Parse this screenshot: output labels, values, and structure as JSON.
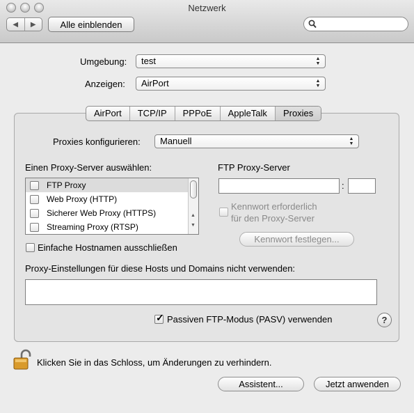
{
  "window": {
    "title": "Netzwerk"
  },
  "toolbar": {
    "back_icon": "◀",
    "forward_icon": "▶",
    "show_all_label": "Alle einblenden",
    "search_placeholder": "",
    "search_icon": "search-icon"
  },
  "location": {
    "label": "Umgebung:",
    "value": "test"
  },
  "show": {
    "label": "Anzeigen:",
    "value": "AirPort"
  },
  "tabs": [
    {
      "label": "AirPort",
      "selected": false
    },
    {
      "label": "TCP/IP",
      "selected": false
    },
    {
      "label": "PPPoE",
      "selected": false
    },
    {
      "label": "AppleTalk",
      "selected": false
    },
    {
      "label": "Proxies",
      "selected": true
    }
  ],
  "proxies": {
    "configure_label": "Proxies konfigurieren:",
    "configure_value": "Manuell",
    "select_server_label": "Einen Proxy-Server auswählen:",
    "server_list": [
      {
        "label": "FTP Proxy",
        "checked": false,
        "selected": true
      },
      {
        "label": "Web Proxy (HTTP)",
        "checked": false,
        "selected": false
      },
      {
        "label": "Sicherer Web Proxy (HTTPS)",
        "checked": false,
        "selected": false
      },
      {
        "label": "Streaming Proxy (RTSP)",
        "checked": false,
        "selected": false
      }
    ],
    "ftp_server_title": "FTP Proxy-Server",
    "ftp_server_value": "",
    "port_separator": ":",
    "port_value": "",
    "password_required_line1": "Kennwort erforderlich",
    "password_required_line2": "für den Proxy-Server",
    "set_password_label": "Kennwort festlegen...",
    "exclude_simple_hostnames_label": "Einfache Hostnamen ausschließen",
    "bypass_label": "Proxy-Einstellungen für diese Hosts und Domains nicht verwenden:",
    "bypass_value": "",
    "passive_ftp_label": "Passiven FTP-Modus (PASV) verwenden",
    "passive_ftp_checked": true,
    "help_label": "?"
  },
  "footer": {
    "lock_text": "Klicken Sie in das Schloss, um Änderungen zu verhindern.",
    "assistant_label": "Assistent...",
    "apply_label": "Jetzt anwenden"
  },
  "colors": {
    "window_bg": "#ececec",
    "selected_row": "#dcdcdc",
    "lock_gold": "#d99a2b"
  }
}
